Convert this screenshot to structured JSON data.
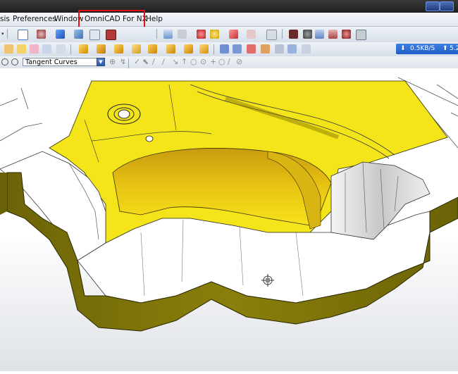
{
  "menubar": {
    "items": [
      "sis",
      "Preferences",
      "Window",
      "OmniCAD For NX",
      "Help"
    ]
  },
  "selection_filter": {
    "value": "Tangent Curves"
  },
  "network": {
    "download": "0.5KB/S",
    "upload": "5.2"
  },
  "colors": {
    "part_yellow": "#f3e51a",
    "wall_olive": "#7d7308",
    "highlight_red": "#e01010",
    "accent_blue": "#2d5aa8"
  }
}
